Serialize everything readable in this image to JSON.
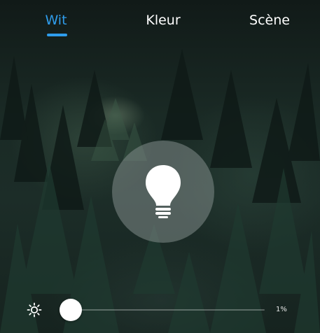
{
  "tabs": [
    {
      "label": "Wit",
      "active": true
    },
    {
      "label": "Kleur",
      "active": false
    },
    {
      "label": "Scène",
      "active": false
    }
  ],
  "accent_color": "#2f9dec",
  "light_button": {
    "icon": "lightbulb-icon"
  },
  "brightness": {
    "icon": "sun-icon",
    "value_label": "1%",
    "fraction": 0.01
  }
}
